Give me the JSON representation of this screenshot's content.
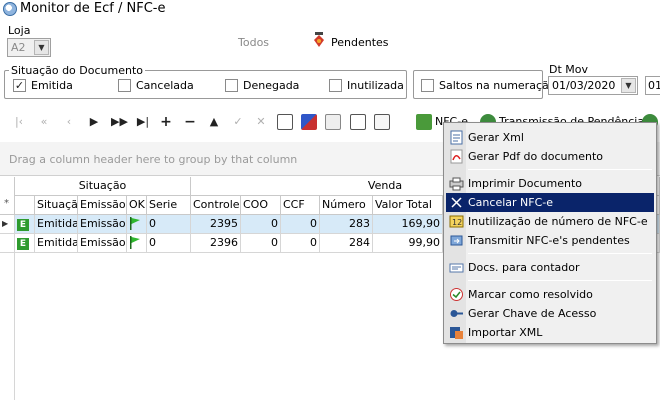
{
  "window": {
    "title": "Monitor de Ecf / NFC-e"
  },
  "filters": {
    "loja_label": "Loja",
    "loja_value": "A2",
    "todos_label": "Todos",
    "pendentes_label": "Pendentes",
    "situacao_group_label": "Situação do Documento",
    "emitida_label": "Emitida",
    "cancelada_label": "Cancelada",
    "denegada_label": "Denegada",
    "inutilizada_label": "Inutilizada",
    "saltos_label": "Saltos na numeração",
    "dtmov_label": "Dt Mov",
    "dtmov_from": "01/03/2020",
    "dtmov_to": "01"
  },
  "toolbar": {
    "nfce_label": "NFC-e",
    "transmissao_label": "Transmissão de Pendências"
  },
  "grid": {
    "group_hint": "Drag a column header here to group by that column",
    "band_situacao": "Situação",
    "band_venda": "Venda",
    "columns": [
      "Situação",
      "Emissão",
      "OK",
      "Serie",
      "Controle",
      "COO",
      "CCF",
      "Número",
      "Valor Total"
    ],
    "rows": [
      {
        "badge": "E",
        "situacao": "Emitida",
        "emissao": "Emissão Normal",
        "serie": "0",
        "controle": "2395",
        "coo": "0",
        "ccf": "0",
        "numero": "283",
        "valor": "169,90"
      },
      {
        "badge": "E",
        "situacao": "Emitida",
        "emissao": "Emissão Normal",
        "serie": "0",
        "controle": "2396",
        "coo": "0",
        "ccf": "0",
        "numero": "284",
        "valor": "99,90"
      }
    ]
  },
  "context_menu": {
    "items": [
      {
        "label": "Gerar Xml",
        "icon": "xml-icon"
      },
      {
        "label": "Gerar Pdf do documento",
        "icon": "pdf-icon"
      },
      {
        "label": "Imprimir Documento",
        "icon": "printer-icon"
      },
      {
        "label": "Cancelar NFC-e",
        "icon": "cancel-x-icon"
      },
      {
        "label": "Inutilização de número de NFC-e",
        "icon": "number-icon"
      },
      {
        "label": "Transmitir NFC-e's pendentes",
        "icon": "transmit-icon"
      },
      {
        "label": "Docs. para contador",
        "icon": "docs-icon"
      },
      {
        "label": "Marcar como resolvido",
        "icon": "resolve-icon"
      },
      {
        "label": "Gerar Chave de Acesso",
        "icon": "key-icon"
      },
      {
        "label": "Importar XML",
        "icon": "import-icon"
      }
    ],
    "active_item": "Cancelar NFC-e"
  }
}
